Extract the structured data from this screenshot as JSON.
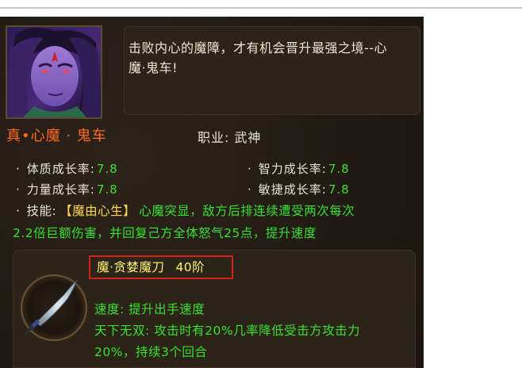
{
  "description": {
    "line1": "击败内心的魔障，才有机会晋升最强之境--心",
    "line2": "魔·鬼车!"
  },
  "character": {
    "name": "真•心魔 · 鬼车",
    "job_label": "职业:",
    "job_value": "武神"
  },
  "stats": [
    {
      "bullet": "·",
      "label": "体质成长率:",
      "value": "7.8"
    },
    {
      "bullet": "·",
      "label": "智力成长率:",
      "value": "7.8"
    },
    {
      "bullet": "·",
      "label": "力量成长率:",
      "value": "7.8"
    },
    {
      "bullet": "·",
      "label": "敏捷成长率:",
      "value": "7.8"
    }
  ],
  "skill": {
    "bullet": "·",
    "label": "技能:",
    "name": "【魔由心生】",
    "text_part1": "心魔突显，敌方后排连续遭受两次每次",
    "text_part2": "2.2倍巨额伤害，并回复己方全体怒气25点，提升速度"
  },
  "weapon": {
    "name": "魔·贪婪魔刀",
    "level": "40阶",
    "line1": "速度: 提升出手速度",
    "line2": "天下无双: 攻击时有20%几率降低受击方攻击力",
    "line3": "20%，持续3个回合"
  }
}
